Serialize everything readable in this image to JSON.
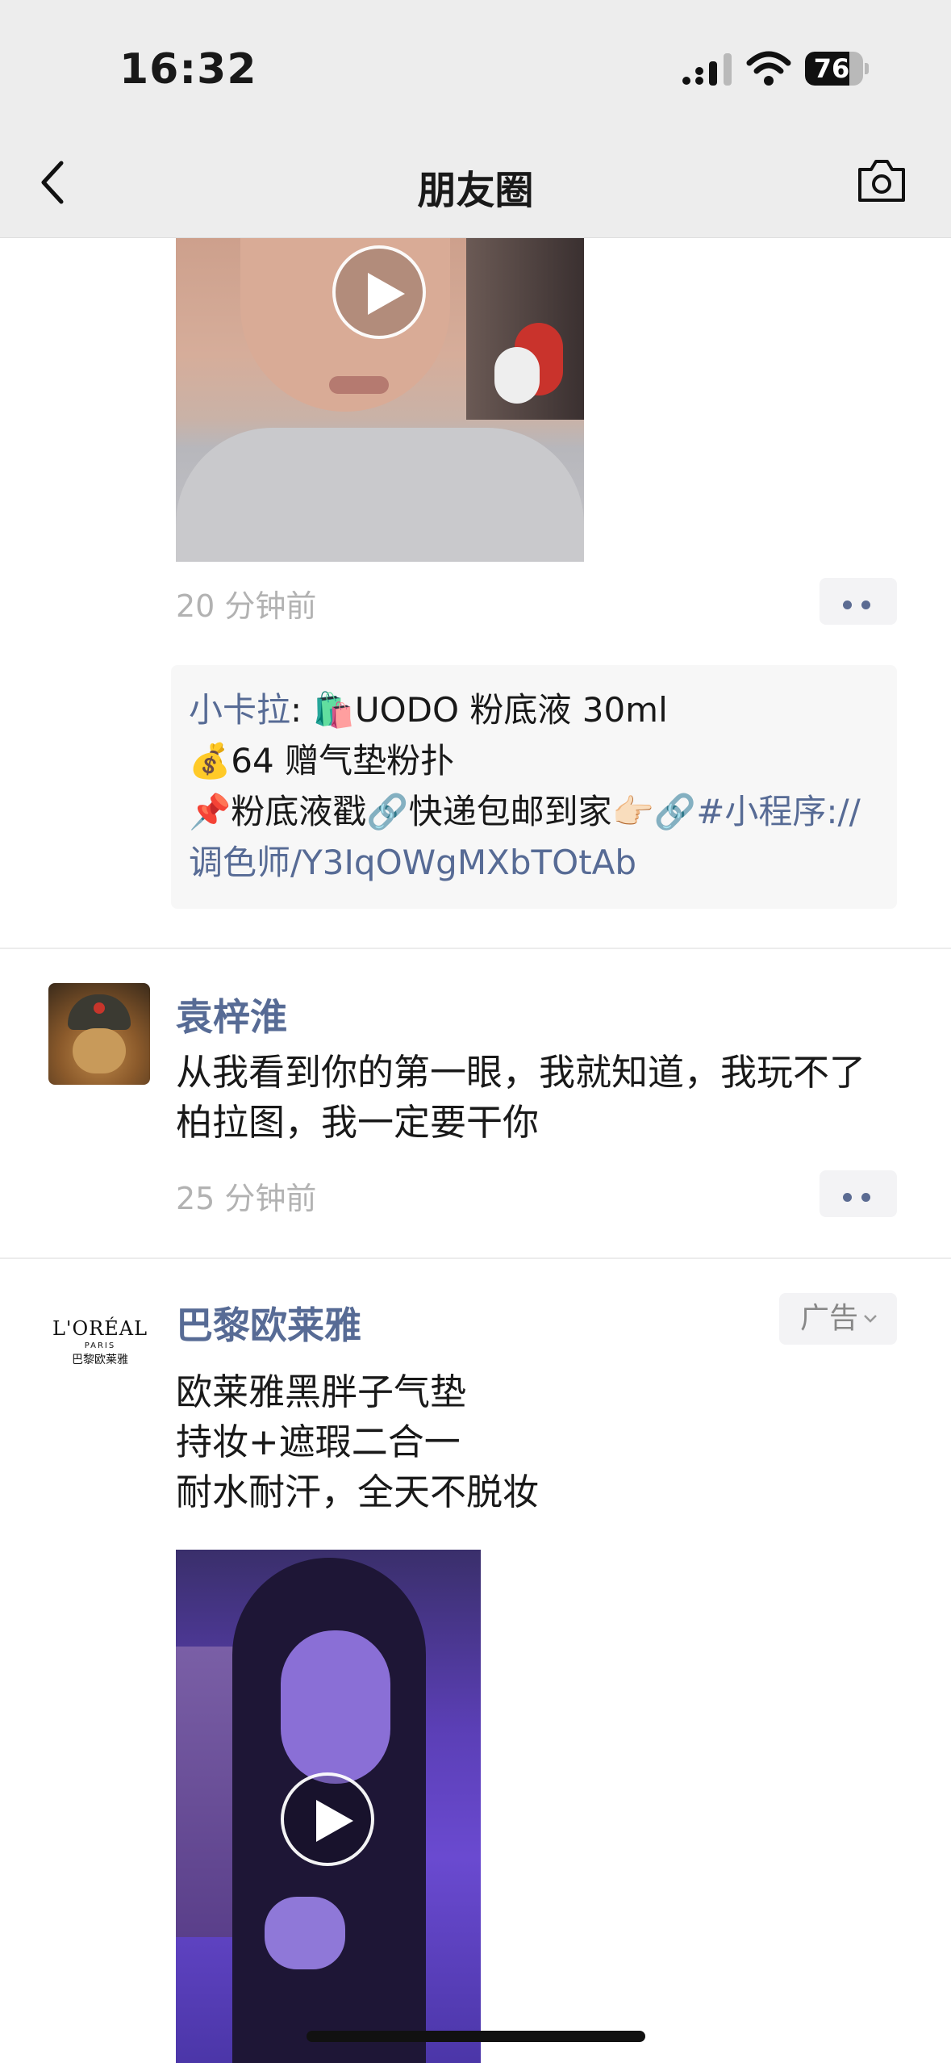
{
  "status_bar": {
    "time": "16:32",
    "battery": "76",
    "battery_level": 0.76
  },
  "nav": {
    "title": "朋友圈",
    "back_icon": "chevron-left-icon",
    "camera_icon": "camera-icon"
  },
  "post1": {
    "time_ago": "20 分钟前",
    "comment": {
      "author": "小卡拉",
      "sep": ": ",
      "line1": "🛍️UODO 粉底液 30ml",
      "line2": "💰64 赠气垫粉扑",
      "line3_a": "📌粉底液戳🔗快递包邮到家👉🏻🔗",
      "line3_link": "#小程序://调色师/Y3IqOWgMXbTOtAb"
    }
  },
  "post2": {
    "author": "袁梓淮",
    "text": "从我看到你的第一眼，我就知道，我玩不了柏拉图，我一定要干你",
    "time_ago": "25 分钟前"
  },
  "post3": {
    "author": "巴黎欧莱雅",
    "logo_brand": "L'ORÉAL",
    "logo_paris": "PARIS",
    "logo_cn": "巴黎欧莱雅",
    "ad_label": "广告",
    "line1": "欧莱雅黑胖子气垫",
    "line2": "持妆+遮瑕二合一",
    "line3": "耐水耐汗，全天不脱妆"
  },
  "colors": {
    "link_blue": "#576b95",
    "nav_bg": "#ededed"
  }
}
